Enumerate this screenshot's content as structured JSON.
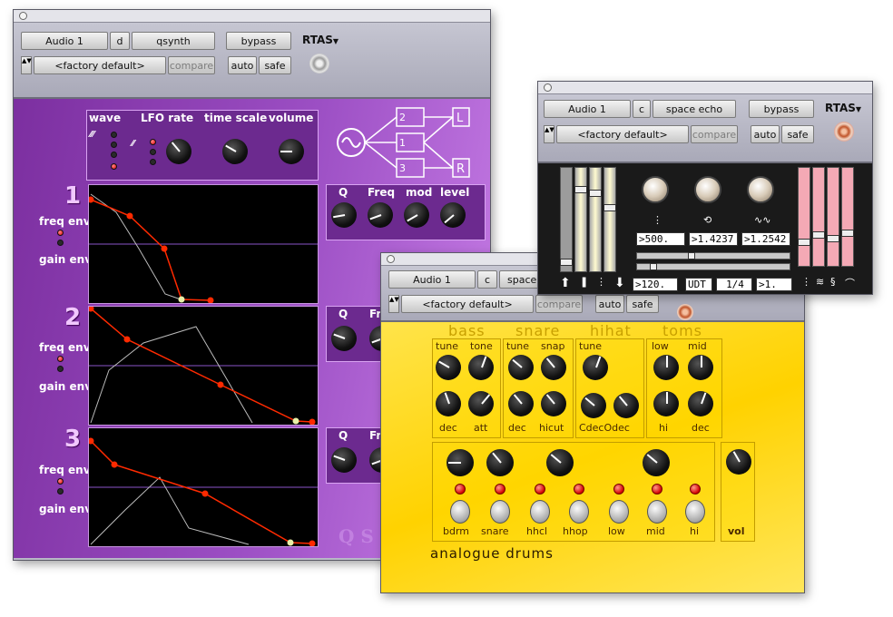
{
  "qsynth": {
    "toolbar": {
      "track": "Audio 1",
      "slot": "d",
      "plugin": "qsynth",
      "bypass": "bypass",
      "format": "RTAS",
      "preset": "<factory default>",
      "compare": "compare",
      "auto": "auto",
      "safe": "safe",
      "preset_arrows": "▲▼",
      "format_arrow": "▼"
    },
    "headers": {
      "wave": "wave",
      "lfo_rate": "LFO rate",
      "time_scale": "time scale",
      "volume": "volume"
    },
    "wave_glyphs": "⁄⁄⁄",
    "filter_labels": [
      "Q",
      "Freq",
      "mod",
      "level"
    ],
    "filter_labels_short": [
      "Q",
      "Fre"
    ],
    "routing": [
      "2",
      "1",
      "3"
    ],
    "routing_out": [
      "L",
      "R"
    ],
    "voices": [
      {
        "num": "1",
        "freq_env": "freq env",
        "gain_env": "gain env"
      },
      {
        "num": "2",
        "freq_env": "freq env",
        "gain_env": "gain env"
      },
      {
        "num": "3",
        "freq_env": "freq env",
        "gain_env": "gain env"
      }
    ],
    "watermark": "Q S"
  },
  "drums": {
    "toolbar": {
      "track": "Audio 1",
      "slot": "c",
      "plugin": "space",
      "preset": "<factory default>",
      "compare": "compare",
      "auto": "auto",
      "safe": "safe",
      "preset_arrows": "▲▼"
    },
    "groups": [
      "bass",
      "snare",
      "hihat",
      "toms"
    ],
    "bass_top": [
      "tune",
      "tone"
    ],
    "bass_bottom": [
      "dec",
      "att"
    ],
    "snare_top": [
      "tune",
      "snap"
    ],
    "snare_bottom": [
      "dec",
      "hicut"
    ],
    "hihat_top": [
      "tune"
    ],
    "hihat_bottom": [
      "CdecOdec"
    ],
    "toms_top": [
      "low",
      "mid"
    ],
    "toms_bottom": [
      "hi",
      "dec"
    ],
    "pads": [
      "bdrm",
      "snare",
      "hhcl",
      "hhop",
      "low",
      "mid",
      "hi"
    ],
    "vol": "vol",
    "title": "analogue drums"
  },
  "echo": {
    "toolbar": {
      "track": "Audio 1",
      "slot": "c",
      "plugin": "space echo",
      "bypass": "bypass",
      "format": "RTAS",
      "preset": "<factory default>",
      "compare": "compare",
      "auto": "auto",
      "safe": "safe",
      "preset_arrows": "▲▼",
      "format_arrow": "▼"
    },
    "fields": [
      ">500.",
      ">1.4237",
      ">1.2542"
    ],
    "bottom": {
      "tempo": ">120.",
      "mode": "UDT",
      "division": "1/4",
      "mult": ">1."
    },
    "icons": {
      "tap": "⋮",
      "loop": "⟲",
      "wave": "∿∿"
    }
  }
}
